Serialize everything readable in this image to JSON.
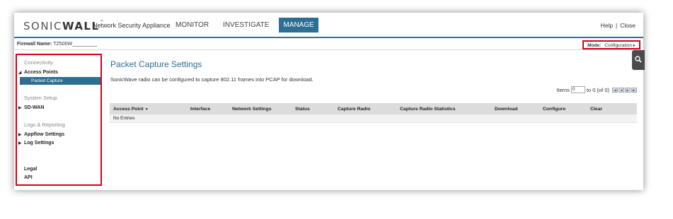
{
  "header": {
    "logo": {
      "part1": "SONIC",
      "part2": "WALL",
      "tm": "™"
    },
    "product": "Network Security Appliance",
    "nav": [
      {
        "label": "MONITOR",
        "active": false
      },
      {
        "label": "INVESTIGATE",
        "active": false
      },
      {
        "label": "MANAGE",
        "active": true
      }
    ],
    "help": "Help",
    "separator": "|",
    "close": "Close"
  },
  "firewall_bar": {
    "label": "Firewall Name:",
    "value": "TZ500W_________",
    "mode_label": "Mode:",
    "mode_value": "Configuration ▸"
  },
  "sidebar": {
    "connectivity": "Connectivity",
    "access_points": "Access Points",
    "packet_capture": "Packet Capture",
    "system_setup": "System Setup",
    "sd_wan": "SD-WAN",
    "logs_reporting": "Logs & Reporting",
    "appflow_settings": "Appflow Settings",
    "log_settings": "Log Settings",
    "legal": "Legal",
    "api": "API"
  },
  "main": {
    "title": "Packet Capture Settings",
    "description": "SonicWave radio can be configured to capture 802.11 frames into PCAP for download.",
    "items_label": "Items",
    "items_value": "0",
    "items_range": "to 0 (of 0)",
    "columns": [
      "Access Point",
      "Interface",
      "Network Settings",
      "Status",
      "Capture Radio",
      "Capture Radio Statistics",
      "Download",
      "Configure",
      "Clear"
    ],
    "sort_indicator": "▼",
    "empty_text": "No Entries"
  },
  "colors": {
    "accent": "#2e6e93",
    "highlight_border": "#d0021b"
  },
  "icons": {
    "search_tab": "search-icon",
    "pager": [
      "first-page-icon",
      "prev-page-icon",
      "next-page-icon",
      "last-page-icon"
    ]
  }
}
